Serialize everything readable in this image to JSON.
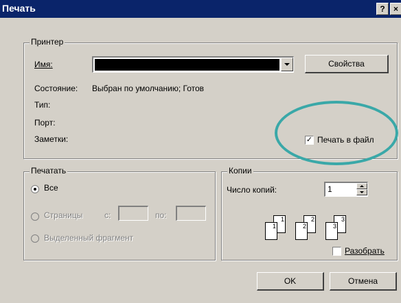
{
  "window": {
    "title": "Печать",
    "help_label": "?",
    "close_label": "×"
  },
  "printer_group": {
    "legend": "Принтер",
    "name_label": "Имя:",
    "name_value": "",
    "properties_button": "Свойства",
    "status_label": "Состояние:",
    "status_value": "Выбран по умолчанию; Готов",
    "type_label": "Тип:",
    "port_label": "Порт:",
    "comments_label": "Заметки:",
    "print_to_file_label": "Печать в файл",
    "print_to_file_checked": true
  },
  "range_group": {
    "legend": "Печатать",
    "all_label": "Все",
    "pages_label": "Страницы",
    "from_label": "с:",
    "to_label": "по:",
    "selection_label": "Выделенный фрагмент",
    "selected": "all"
  },
  "copies_group": {
    "legend": "Копии",
    "count_label": "Число копий:",
    "count_value": "1",
    "collate_label": "Разобрать",
    "collate_checked": false,
    "pages": [
      "1",
      "1",
      "2",
      "2",
      "3",
      "3"
    ]
  },
  "buttons": {
    "ok": "OK",
    "cancel": "Отмена"
  },
  "colors": {
    "titlebar": "#0a246a",
    "face": "#d4d0c8",
    "highlight_oval": "#3aa8a8"
  }
}
